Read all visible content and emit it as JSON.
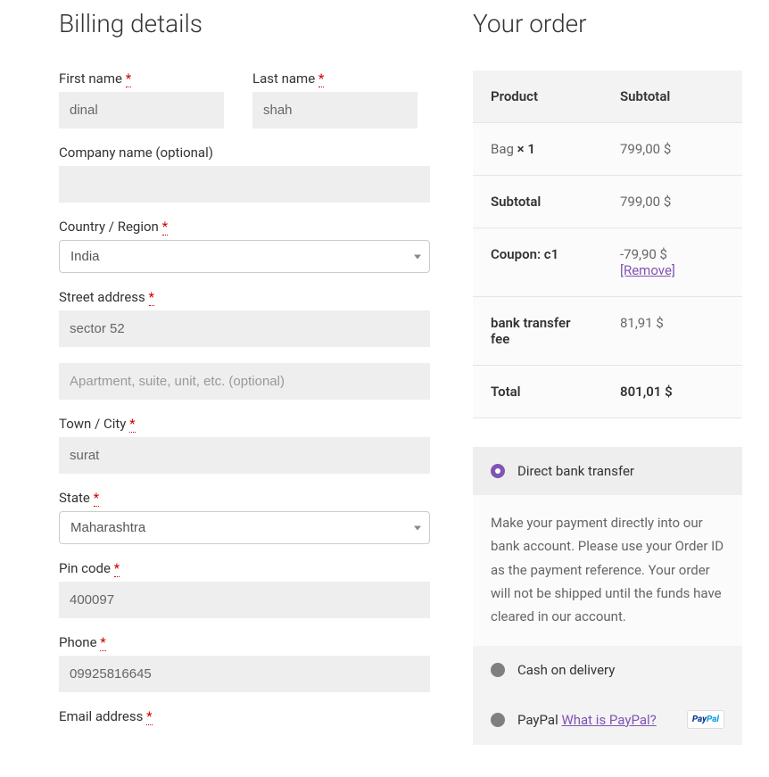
{
  "billing": {
    "title": "Billing details",
    "first_name_label": "First name",
    "first_name_value": "dinal",
    "last_name_label": "Last name",
    "last_name_value": "shah",
    "company_label": "Company name (optional)",
    "company_value": "",
    "country_label": "Country / Region",
    "country_value": "India",
    "street_label": "Street address",
    "street_value": "sector 52",
    "street2_placeholder": "Apartment, suite, unit, etc. (optional)",
    "street2_value": "",
    "city_label": "Town / City",
    "city_value": "surat",
    "state_label": "State",
    "state_value": "Maharashtra",
    "pin_label": "Pin code",
    "pin_value": "400097",
    "phone_label": "Phone",
    "phone_value": "09925816645",
    "email_label": "Email address"
  },
  "order": {
    "title": "Your order",
    "product_header": "Product",
    "subtotal_header": "Subtotal",
    "item_name": "Bag ",
    "item_qty": " × 1",
    "item_price": "799,00 $",
    "subtotal_label": "Subtotal",
    "subtotal_value": "799,00 $",
    "coupon_label": "Coupon: c1",
    "coupon_value": "-79,90 $ ",
    "remove_text": "[Remove]",
    "bank_fee_label": "bank transfer fee",
    "bank_fee_value": "81,91 $",
    "total_label": "Total",
    "total_value": "801,01 $"
  },
  "payment": {
    "direct_bank": "Direct bank transfer",
    "direct_bank_desc": "Make your payment directly into our bank account. Please use your Order ID as the payment reference. Your order will not be shipped until the funds have cleared in our account.",
    "cod": "Cash on delivery",
    "paypal": "PayPal ",
    "paypal_link": "What is PayPal?"
  },
  "required_symbol": "*"
}
